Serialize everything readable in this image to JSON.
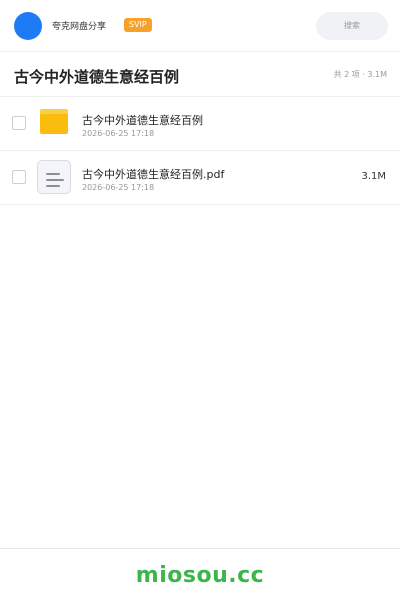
{
  "header": {
    "user_name": "夸克网盘分享",
    "badge": "SVIP",
    "search_placeholder": "搜索"
  },
  "title_row": {
    "title": "古今中外道德生意经百例",
    "summary": "共 2 项 · 3.1M"
  },
  "files": [
    {
      "name": "古今中外道德生意经百例",
      "date": "2026-06-25 17:18",
      "size": "",
      "icon": "folder-icon"
    },
    {
      "name": "古今中外道德生意经百例.pdf",
      "date": "2026-06-25 17:18",
      "size": "3.1M",
      "icon": "document-icon"
    }
  ],
  "footer": {
    "brand": "miosou.cc"
  },
  "colors": {
    "avatar": "#1e7bf5",
    "badge": "#f7a12b",
    "folder": "#fbbd0d",
    "brand": "#3cb54a"
  }
}
